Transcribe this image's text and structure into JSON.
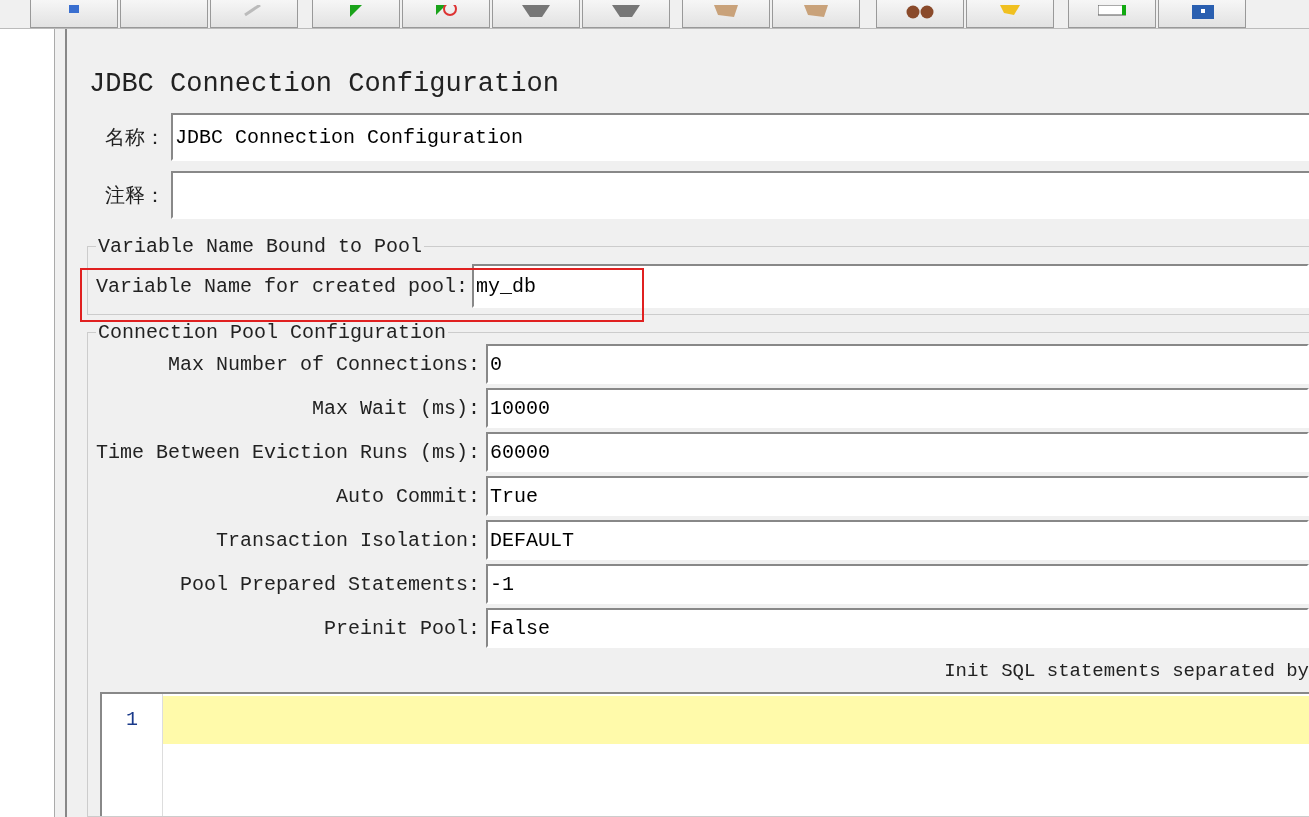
{
  "title": "JDBC Connection Configuration",
  "name_field": {
    "label": "名称：",
    "value": "JDBC Connection Configuration"
  },
  "comment_field": {
    "label": "注释："
  },
  "variable_group": {
    "title": "Variable Name Bound to Pool",
    "fields": [
      {
        "label": "Variable Name for created pool:",
        "value": "my_db",
        "highlighted": true
      }
    ]
  },
  "pool_group": {
    "title": "Connection Pool Configuration",
    "fields": [
      {
        "label": "Max Number of Connections:",
        "value": "0"
      },
      {
        "label": "Max Wait (ms):",
        "value": "10000"
      },
      {
        "label": "Time Between Eviction Runs (ms):",
        "value": "60000"
      },
      {
        "label": "Auto Commit:",
        "value": "True"
      },
      {
        "label": "Transaction Isolation:",
        "value": "DEFAULT"
      },
      {
        "label": "Pool Prepared Statements:",
        "value": "-1"
      },
      {
        "label": "Preinit Pool:",
        "value": "False"
      }
    ]
  },
  "init_sql": {
    "label": "Init SQL statements separated by",
    "line_numbers": [
      "1"
    ]
  }
}
